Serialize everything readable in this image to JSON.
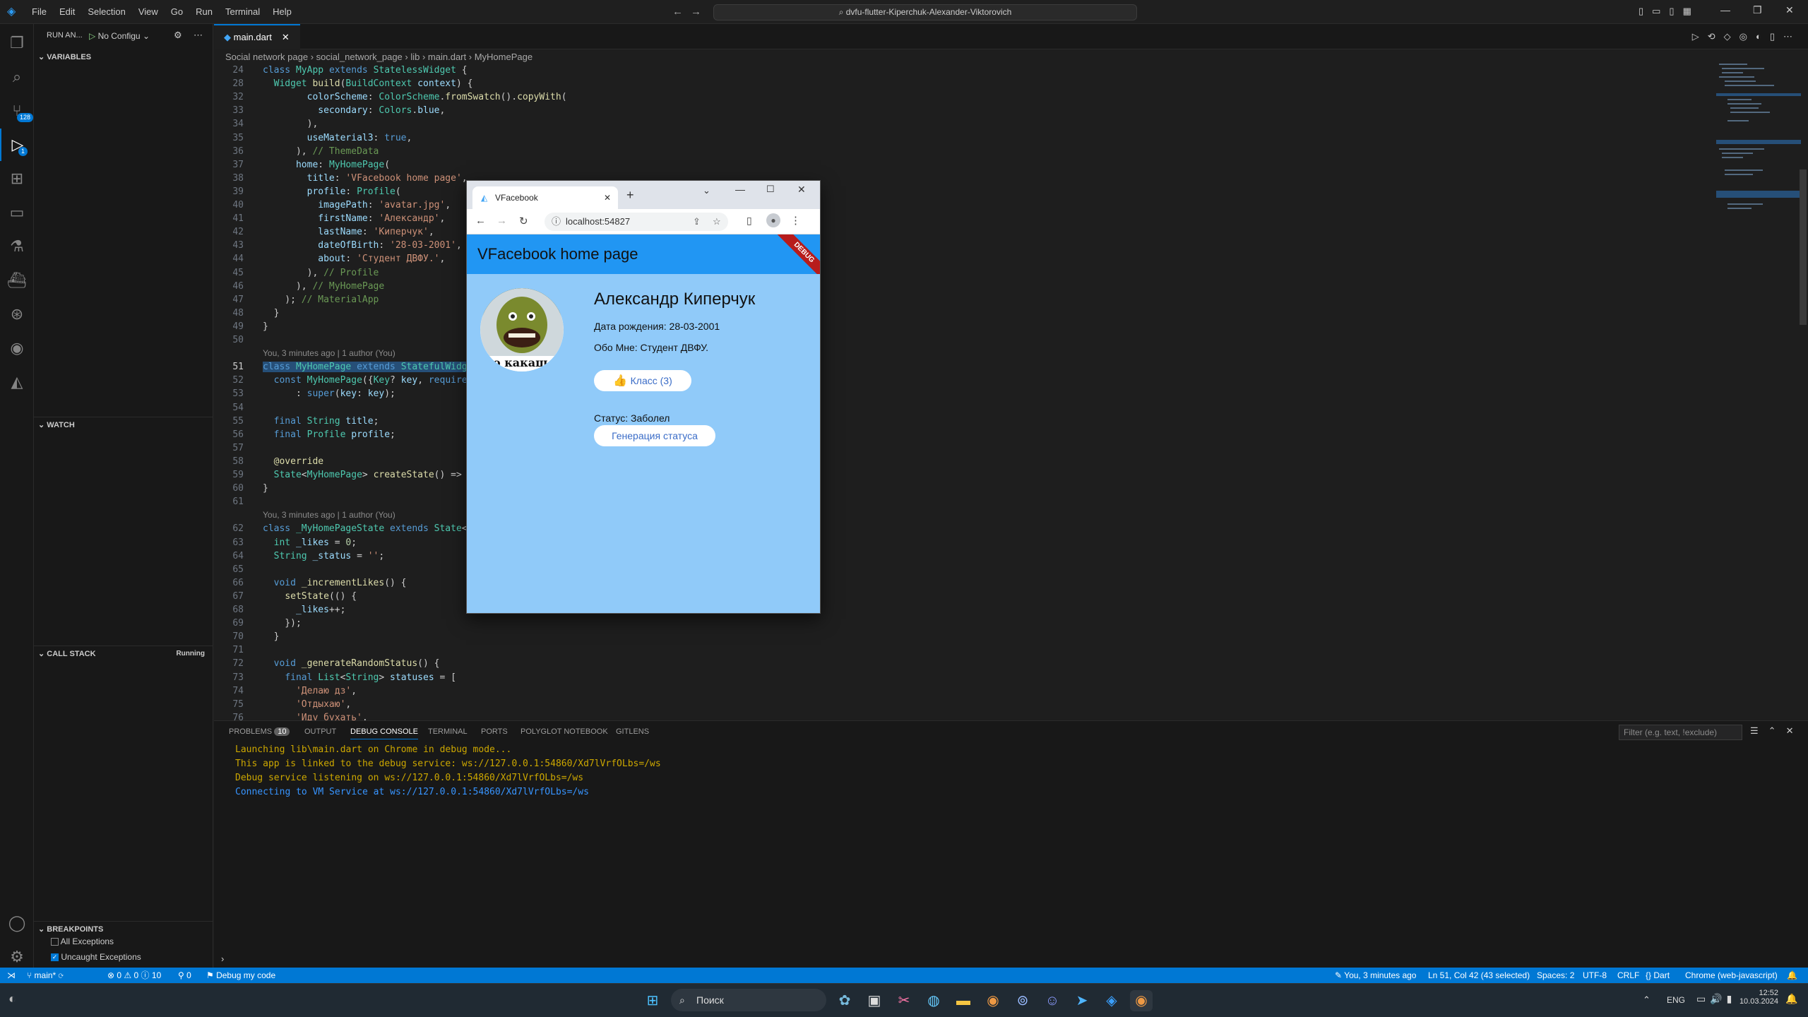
{
  "menu": [
    "File",
    "Edit",
    "Selection",
    "View",
    "Go",
    "Run",
    "Terminal",
    "Help"
  ],
  "command_center": "dvfu-flutter-Kiperchuk-Alexander-Viktorovich",
  "debug_toolbar": {
    "icons": [
      "drag-icon",
      "pause-icon",
      "step-over-icon",
      "step-into-icon",
      "step-out-icon",
      "hot-reload-icon",
      "restart-icon",
      "stop-icon",
      "devtools-icon"
    ]
  },
  "activity": {
    "badges": {
      "scm": "128",
      "debug": "1"
    }
  },
  "sidebar": {
    "title": "RUN AN...",
    "config": "No Configu",
    "variables": "VARIABLES",
    "watch": "WATCH",
    "callstack": "CALL STACK",
    "callstack_state": "Running",
    "breakpoints": "BREAKPOINTS",
    "bp_items": [
      {
        "label": "All Exceptions",
        "checked": false
      },
      {
        "label": "Uncaught Exceptions",
        "checked": true
      }
    ]
  },
  "editor": {
    "tab": "main.dart",
    "breadcrumb": [
      "Social network page",
      "social_network_page",
      "lib",
      "main.dart",
      "MyHomePage"
    ],
    "blame1": "You, 3 minutes ago | 1 author (You)",
    "blame2": "You, 3 minutes ago | 1 author (You)"
  },
  "code": [
    {
      "n": "24",
      "html": "<span class='k'>class</span> <span class='t'>MyApp</span> <span class='k'>extends</span> <span class='t'>StatelessWidget</span> {"
    },
    {
      "n": "28",
      "html": "  <span class='t'>Widget</span> <span class='f'>build</span>(<span class='t'>BuildContext</span> <span class='v'>context</span>) {"
    },
    {
      "n": "32",
      "html": "        <span class='v'>colorScheme</span>: <span class='t'>ColorScheme</span>.<span class='f'>fromSwatch</span>().<span class='f'>copyWith</span>("
    },
    {
      "n": "33",
      "html": "          <span class='v'>secondary</span>: <span class='t'>Colors</span>.<span class='v'>blue</span>,"
    },
    {
      "n": "34",
      "html": "        ),"
    },
    {
      "n": "35",
      "html": "        <span class='v'>useMaterial3</span>: <span class='k'>true</span>,"
    },
    {
      "n": "36",
      "html": "      ), <span class='c'>// ThemeData</span>"
    },
    {
      "n": "37",
      "html": "      <span class='v'>home</span>: <span class='t'>MyHomePage</span>("
    },
    {
      "n": "38",
      "html": "        <span class='v'>title</span>: <span class='s'>'VFacebook home page'</span>,"
    },
    {
      "n": "39",
      "html": "        <span class='v'>profile</span>: <span class='t'>Profile</span>("
    },
    {
      "n": "40",
      "html": "          <span class='v'>imagePath</span>: <span class='s'>'avatar.jpg'</span>,"
    },
    {
      "n": "41",
      "html": "          <span class='v'>firstName</span>: <span class='s'>'Александр'</span>,"
    },
    {
      "n": "42",
      "html": "          <span class='v'>lastName</span>: <span class='s'>'Киперчук'</span>,"
    },
    {
      "n": "43",
      "html": "          <span class='v'>dateOfBirth</span>: <span class='s'>'28-03-2001'</span>,"
    },
    {
      "n": "44",
      "html": "          <span class='v'>about</span>: <span class='s'>'Студент ДВФУ.'</span>,"
    },
    {
      "n": "45",
      "html": "        ), <span class='c'>// Profile</span>"
    },
    {
      "n": "46",
      "html": "      ), <span class='c'>// MyHomePage</span>"
    },
    {
      "n": "47",
      "html": "    ); <span class='c'>// MaterialApp</span>"
    },
    {
      "n": "48",
      "html": "  }"
    },
    {
      "n": "49",
      "html": "}"
    },
    {
      "n": "50",
      "html": ""
    },
    {
      "n": "51",
      "html": "<span class='k'>class</span> <span class='t'>MyHomePage</span> <span class='k'>extends</span> <span class='t'>StatefulWidge</span>"
    },
    {
      "n": "52",
      "html": "  <span class='k'>const</span> <span class='t'>MyHomePage</span>({<span class='t'>Key</span>? <span class='v'>key</span>, <span class='k'>required</span>"
    },
    {
      "n": "53",
      "html": "      : <span class='k'>super</span>(<span class='v'>key</span>: <span class='v'>key</span>);"
    },
    {
      "n": "54",
      "html": ""
    },
    {
      "n": "55",
      "html": "  <span class='k'>final</span> <span class='t'>String</span> <span class='v'>title</span>;"
    },
    {
      "n": "56",
      "html": "  <span class='k'>final</span> <span class='t'>Profile</span> <span class='v'>profile</span>;"
    },
    {
      "n": "57",
      "html": ""
    },
    {
      "n": "58",
      "html": "  <span class='f'>@override</span>"
    },
    {
      "n": "59",
      "html": "  <span class='t'>State</span>&lt;<span class='t'>MyHomePage</span>&gt; <span class='f'>createState</span>() =&gt;"
    },
    {
      "n": "60",
      "html": "}"
    },
    {
      "n": "61",
      "html": ""
    },
    {
      "n": "62",
      "html": "<span class='k'>class</span> <span class='t'>_MyHomePageState</span> <span class='k'>extends</span> <span class='t'>State</span>&lt;"
    },
    {
      "n": "63",
      "html": "  <span class='t'>int</span> <span class='v'>_likes</span> = <span class='n'>0</span>;"
    },
    {
      "n": "64",
      "html": "  <span class='t'>String</span> <span class='v'>_status</span> = <span class='s'>''</span>;"
    },
    {
      "n": "65",
      "html": ""
    },
    {
      "n": "66",
      "html": "  <span class='k'>void</span> <span class='f'>_incrementLikes</span>() {"
    },
    {
      "n": "67",
      "html": "    <span class='f'>setState</span>(() {"
    },
    {
      "n": "68",
      "html": "      <span class='v'>_likes</span>++;"
    },
    {
      "n": "69",
      "html": "    });"
    },
    {
      "n": "70",
      "html": "  }"
    },
    {
      "n": "71",
      "html": ""
    },
    {
      "n": "72",
      "html": "  <span class='k'>void</span> <span class='f'>_generateRandomStatus</span>() {"
    },
    {
      "n": "73",
      "html": "    <span class='k'>final</span> <span class='t'>List</span>&lt;<span class='t'>String</span>&gt; <span class='v'>statuses</span> = ["
    },
    {
      "n": "74",
      "html": "      <span class='s'>'Делаю дз'</span>,"
    },
    {
      "n": "75",
      "html": "      <span class='s'>'Отдыхаю'</span>,"
    },
    {
      "n": "76",
      "html": "      <span class='s'>'Иду бухать'</span>,"
    }
  ],
  "panel": {
    "tabs": [
      "PROBLEMS",
      "OUTPUT",
      "DEBUG CONSOLE",
      "TERMINAL",
      "PORTS",
      "POLYGLOT NOTEBOOK",
      "GITLENS"
    ],
    "problems_count": "10",
    "filter_placeholder": "Filter (e.g. text, !exclude)",
    "console": [
      {
        "text": "Launching lib\\main.dart on Chrome in debug mode...",
        "color": "#cca700"
      },
      {
        "text": "This app is linked to the debug service: ws://127.0.0.1:54860/Xd7lVrfOLbs=/ws",
        "color": "#cca700"
      },
      {
        "text": "Debug service listening on ws://127.0.0.1:54860/Xd7lVrfOLbs=/ws",
        "color": "#cca700"
      },
      {
        "text": "Connecting to VM Service at ws://127.0.0.1:54860/Xd7lVrfOLbs=/ws",
        "color": "#3794ff"
      }
    ]
  },
  "statusbar": {
    "branch": "main*",
    "errors": "0",
    "warnings": "0",
    "infos": "10",
    "ports": "0",
    "debug": "Debug my code",
    "blame": "You, 3 minutes ago",
    "position": "Ln 51, Col 42 (43 selected)",
    "spaces": "Spaces: 2",
    "encoding": "UTF-8",
    "eol": "CRLF",
    "language": "Dart",
    "device": "Chrome (web-javascript)"
  },
  "taskbar": {
    "search": "Поиск",
    "lang": "ENG",
    "time": "12:52",
    "date": "10.03.2024"
  },
  "browser": {
    "tab_title": "VFacebook",
    "url": "localhost:54827",
    "app_title": "VFacebook home page",
    "debug_banner": "DEBUG",
    "name": "Александр Киперчук",
    "dob": "Дата рождения: 28-03-2001",
    "about": "Обо Мне: Студент ДВФУ.",
    "like_button": "Класс (3)",
    "status": "Статус: Заболел",
    "status_button": "Генерация статуса",
    "avatar_caption": "о какаш"
  },
  "colors": {
    "accent": "#0078d4",
    "app_bar": "#2196f3",
    "app_body": "#90caf9"
  }
}
